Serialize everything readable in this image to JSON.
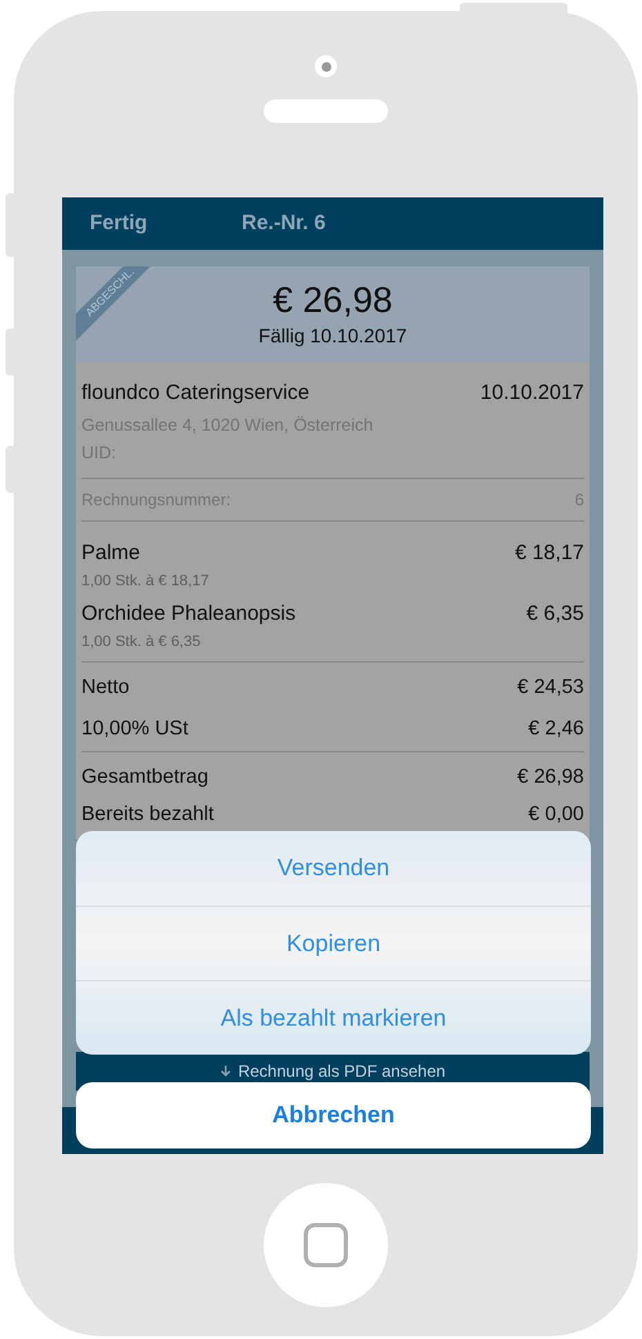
{
  "nav_bar": {
    "left_button": "Fertig",
    "title": "Re.-Nr. 6"
  },
  "invoice": {
    "ribbon": "ABGESCHL.",
    "total": "€ 26,98",
    "due": "Fällig 10.10.2017",
    "customer": {
      "name": "floundco Cateringservice",
      "date": "10.10.2017",
      "address": "Genussallee 4, 1020 Wien, Österreich",
      "uid": "UID:"
    },
    "invoice_number": {
      "label": "Rechnungsnummer:",
      "value": "6"
    },
    "items": [
      {
        "name": "Palme",
        "amount": "€ 18,17",
        "detail": "1,00 Stk. à € 18,17"
      },
      {
        "name": "Orchidee Phaleanopsis",
        "amount": "€ 6,35",
        "detail": "1,00 Stk. à € 6,35"
      }
    ],
    "subtotals": [
      {
        "label": "Netto",
        "value": "€ 24,53"
      },
      {
        "label": "10,00% USt",
        "value": "€ 2,46"
      }
    ],
    "totals": [
      {
        "label": "Gesamtbetrag",
        "value": "€ 26,98"
      },
      {
        "label": "Bereits bezahlt",
        "value": "€ 0,00"
      }
    ]
  },
  "pdf_button": "Rechnung als PDF ansehen",
  "action_sheet": {
    "actions": [
      "Versenden",
      "Kopieren",
      "Als bezahlt markieren"
    ],
    "cancel": "Abbrechen"
  }
}
